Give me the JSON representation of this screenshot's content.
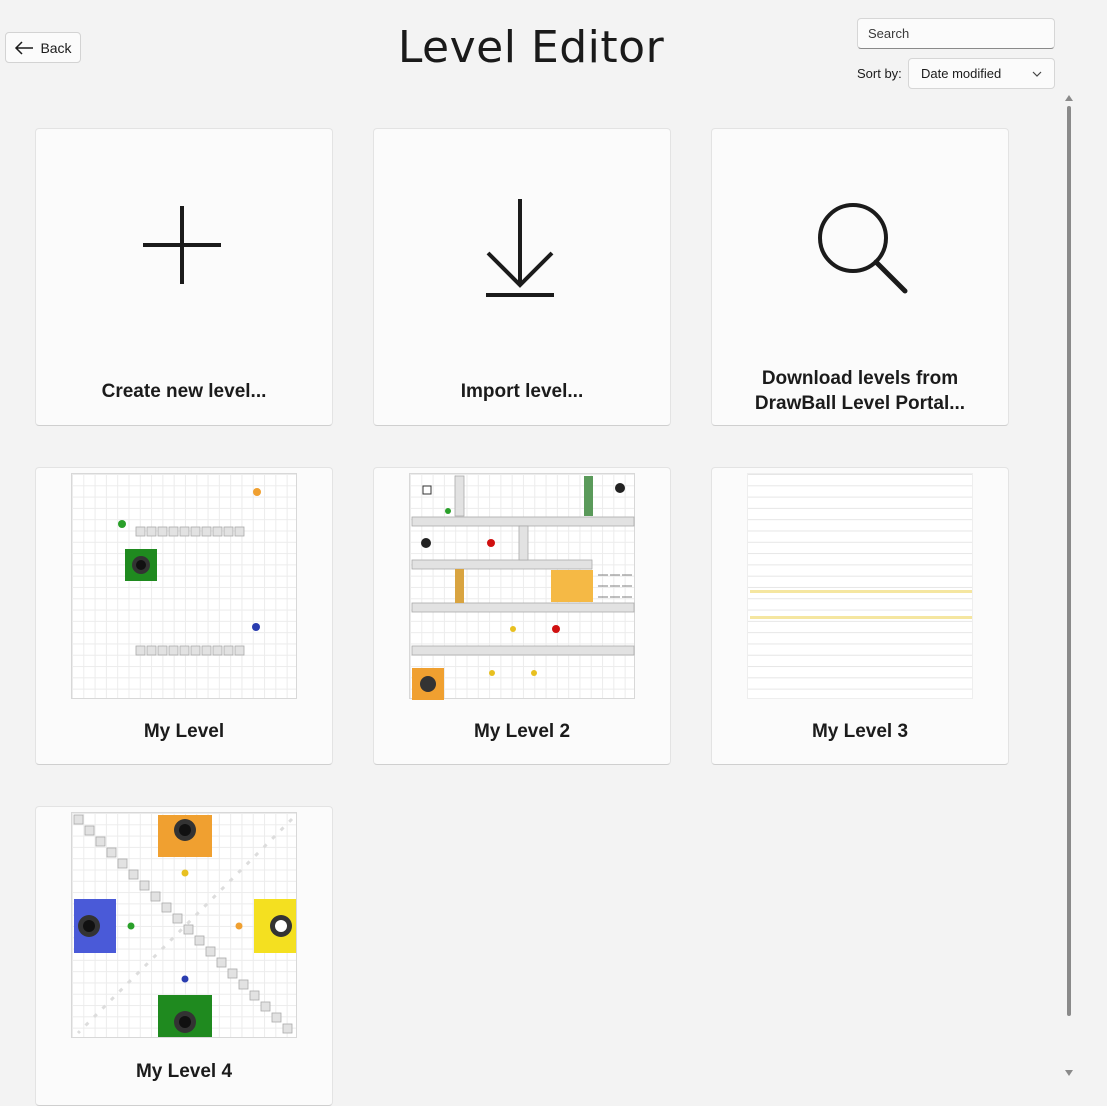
{
  "header": {
    "back_label": "Back",
    "title": "Level Editor",
    "search_placeholder": "Search",
    "sort_label": "Sort by:",
    "sort_value": "Date modified"
  },
  "actions": [
    {
      "label": "Create new level...",
      "icon": "plus-icon"
    },
    {
      "label": "Import level...",
      "icon": "download-arrow-icon"
    },
    {
      "label_line1": "Download levels from",
      "label_line2": "DrawBall Level Portal...",
      "icon": "search-magnifier-icon"
    }
  ],
  "levels": [
    {
      "name": "My Level"
    },
    {
      "name": "My Level 2"
    },
    {
      "name": "My Level 3"
    },
    {
      "name": "My Level 4"
    }
  ],
  "colors": {
    "green": "#1f8a1f",
    "orange": "#f0a030",
    "blue": "#2a3db0",
    "yellow": "#f4e020",
    "red": "#d01010"
  }
}
